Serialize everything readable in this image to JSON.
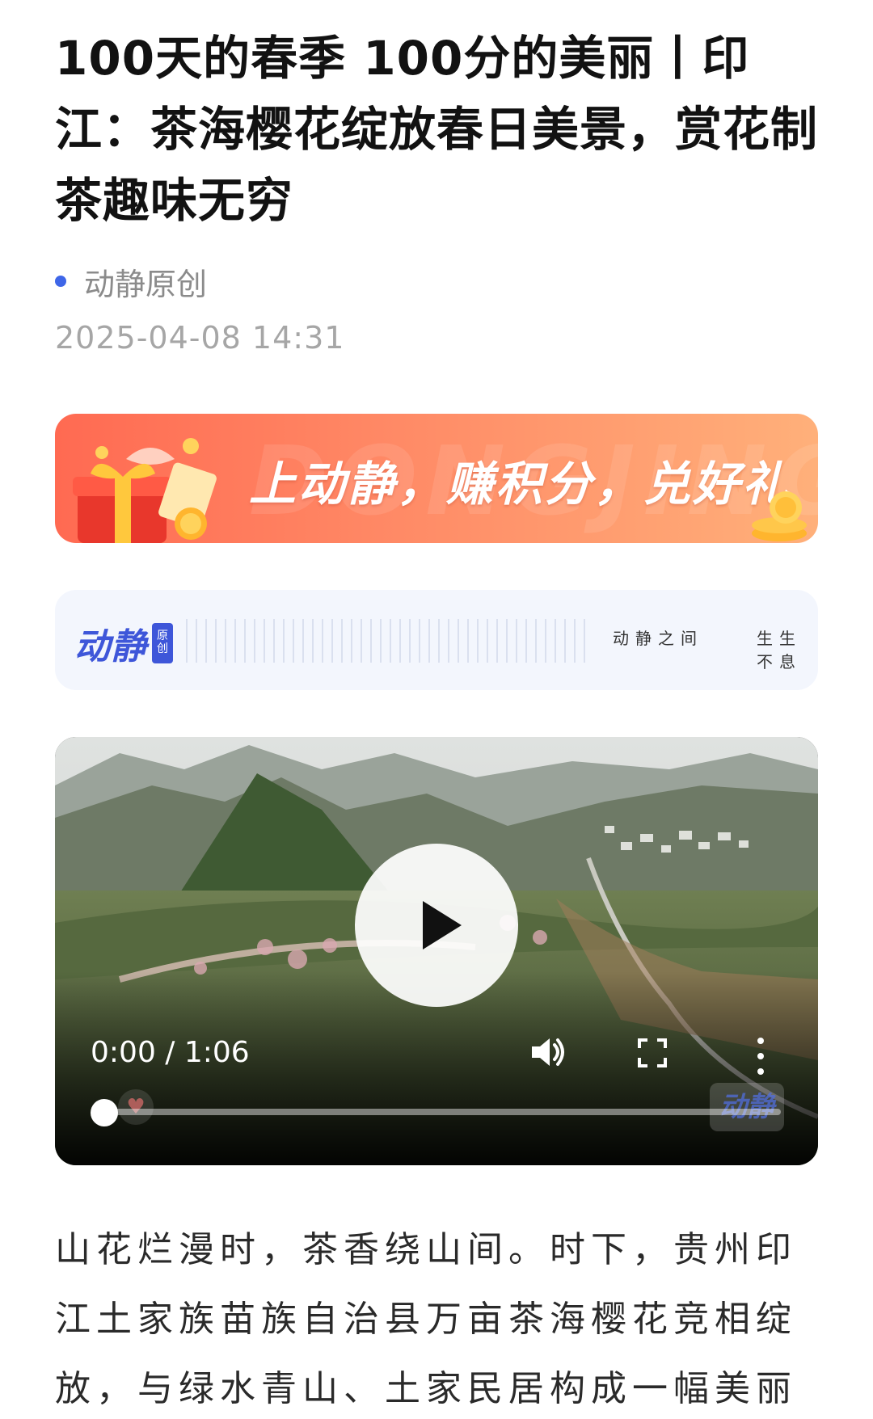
{
  "article": {
    "title": "100天的春季 100分的美丽丨印江：茶海樱花绽放春日美景，赏花制茶趣味无穷",
    "source": "动静原创",
    "datetime": "2025-04-08 14:31",
    "body": "山花烂漫时，茶香绕山间。时下，贵州印江土家族苗族自治县万亩茶海樱花竞相绽放，与绿水青山、土家民居构成一幅美丽"
  },
  "promo_banner": {
    "text": "上动静，赚积分，兑好礼",
    "watermark": "DONGJING",
    "colors": {
      "start": "#ff6a52",
      "end": "#ffb07a"
    }
  },
  "brand_strip": {
    "logo_text": "动静",
    "logo_badge": "原创",
    "slogan_left": "动静之间",
    "slogan_right": "生生不息",
    "accent": "#3e56d9"
  },
  "video": {
    "time_display": "0:00 / 1:06",
    "progress": 0,
    "watermark": "动静",
    "icons": [
      "play-icon",
      "volume-icon",
      "fullscreen-icon",
      "more-vertical-icon",
      "heart-icon"
    ]
  },
  "colors": {
    "source_dot": "#3e66e8",
    "title": "#121212",
    "meta": "#8b8b8b"
  }
}
